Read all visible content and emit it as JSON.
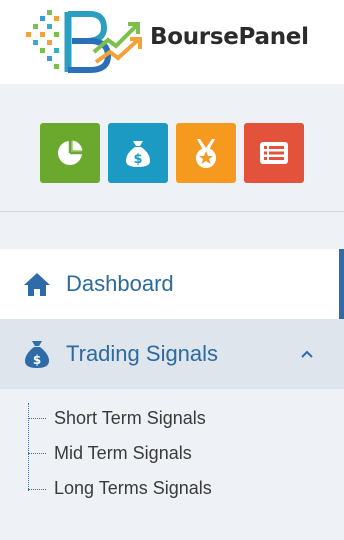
{
  "brand": {
    "name": "BoursePanel"
  },
  "shortcuts": [
    {
      "icon": "pie-chart-icon",
      "color": "#6aa82e"
    },
    {
      "icon": "money-bag-icon",
      "color": "#1b9bc4"
    },
    {
      "icon": "medal-icon",
      "color": "#f59a1f"
    },
    {
      "icon": "list-icon",
      "color": "#e3533b"
    }
  ],
  "nav": {
    "dashboard": {
      "label": "Dashboard",
      "icon": "home-icon"
    },
    "trading_signals": {
      "label": "Trading Signals",
      "icon": "money-bag-icon",
      "expanded": true,
      "children": [
        {
          "label": "Short Term Signals"
        },
        {
          "label": "Mid Term Signals"
        },
        {
          "label": "Long Terms Signals"
        }
      ]
    }
  },
  "colors": {
    "accent": "#2d6ca7",
    "active_bg": "#dfe5ec",
    "sidebar_bg": "#eef1f5"
  }
}
